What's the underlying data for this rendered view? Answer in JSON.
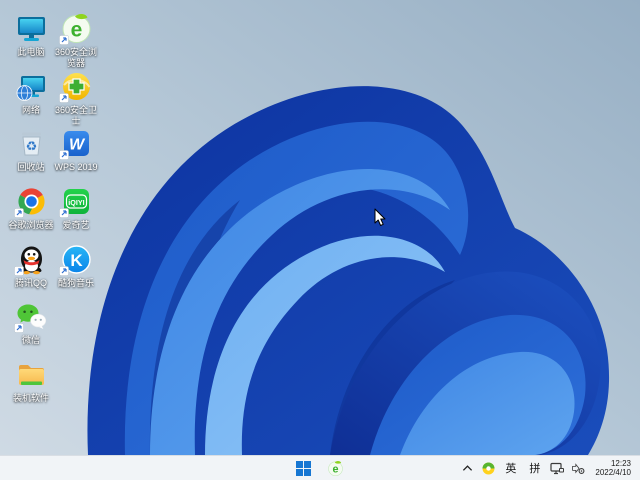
{
  "wallpaper": {
    "name": "windows-11-bloom",
    "bg_top_right": "#97afc4",
    "bg_bottom_left": "#cfdae4",
    "bloom_deep_blue": "#0d33a0",
    "bloom_mid_blue": "#2e6fd9",
    "bloom_bright_blue": "#5ea4ef"
  },
  "desktop": {
    "icons": [
      {
        "label": "此电脑",
        "icon": "this-pc-icon",
        "shortcut": false
      },
      {
        "label": "360安全浏览器",
        "icon": "360-browser-icon",
        "shortcut": true
      },
      {
        "label": "网络",
        "icon": "network-icon",
        "shortcut": false
      },
      {
        "label": "360安全卫士",
        "icon": "360-security-icon",
        "shortcut": true
      },
      {
        "label": "回收站",
        "icon": "recycle-bin-icon",
        "shortcut": false
      },
      {
        "label": "WPS 2019",
        "icon": "wps-icon",
        "shortcut": true
      },
      {
        "label": "谷歌浏览器",
        "icon": "chrome-icon",
        "shortcut": true
      },
      {
        "label": "爱奇艺",
        "icon": "iqiyi-icon",
        "shortcut": true
      },
      {
        "label": "腾讯QQ",
        "icon": "qq-icon",
        "shortcut": true
      },
      {
        "label": "酷狗音乐",
        "icon": "kugou-icon",
        "shortcut": true
      },
      {
        "label": "微信",
        "icon": "wechat-icon",
        "shortcut": true
      },
      {
        "label": "装机软件",
        "icon": "folder-icon",
        "shortcut": false
      }
    ],
    "logo_letters": {
      "browser_e": "e",
      "wps": "W",
      "iqiyi": "iQIYI",
      "kugou": "K",
      "recycle_symbol": "♻",
      "taskbar_browser_e": "e"
    }
  },
  "taskbar": {
    "background": "#f1f4f7",
    "start_color": "#1676d2",
    "tray": {
      "ime_lang": "英",
      "ime_mode": "拼"
    },
    "clock": {
      "time": "12:23",
      "date": "2022/4/10"
    }
  }
}
